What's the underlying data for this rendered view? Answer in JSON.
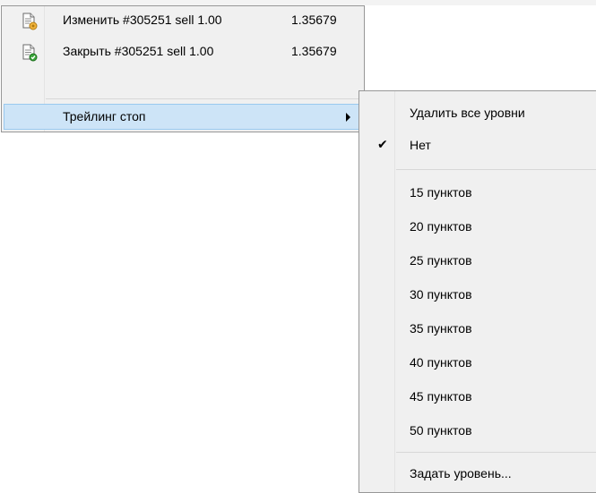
{
  "main_menu": {
    "items": [
      {
        "label": "Изменить #305251 sell 1.00",
        "value": "1.35679",
        "icon": "modify-order-icon"
      },
      {
        "label": "Закрыть #305251 sell 1.00",
        "value": "1.35679",
        "icon": "close-order-icon"
      },
      {
        "label": "Трейлинг стоп",
        "icon": "submenu-arrow-icon"
      }
    ]
  },
  "submenu": {
    "delete_all": "Удалить все уровни",
    "none": "Нет",
    "levels": [
      "15 пунктов",
      "20 пунктов",
      "25 пунктов",
      "30 пунктов",
      "35 пунктов",
      "40 пунктов",
      "45 пунктов",
      "50 пунктов"
    ],
    "custom": "Задать уровень...",
    "check_symbol": "✔"
  },
  "colors": {
    "menu_bg": "#f0f0f0",
    "highlight_bg": "#cde4f7",
    "highlight_border": "#99c9ef",
    "border": "#979797"
  }
}
